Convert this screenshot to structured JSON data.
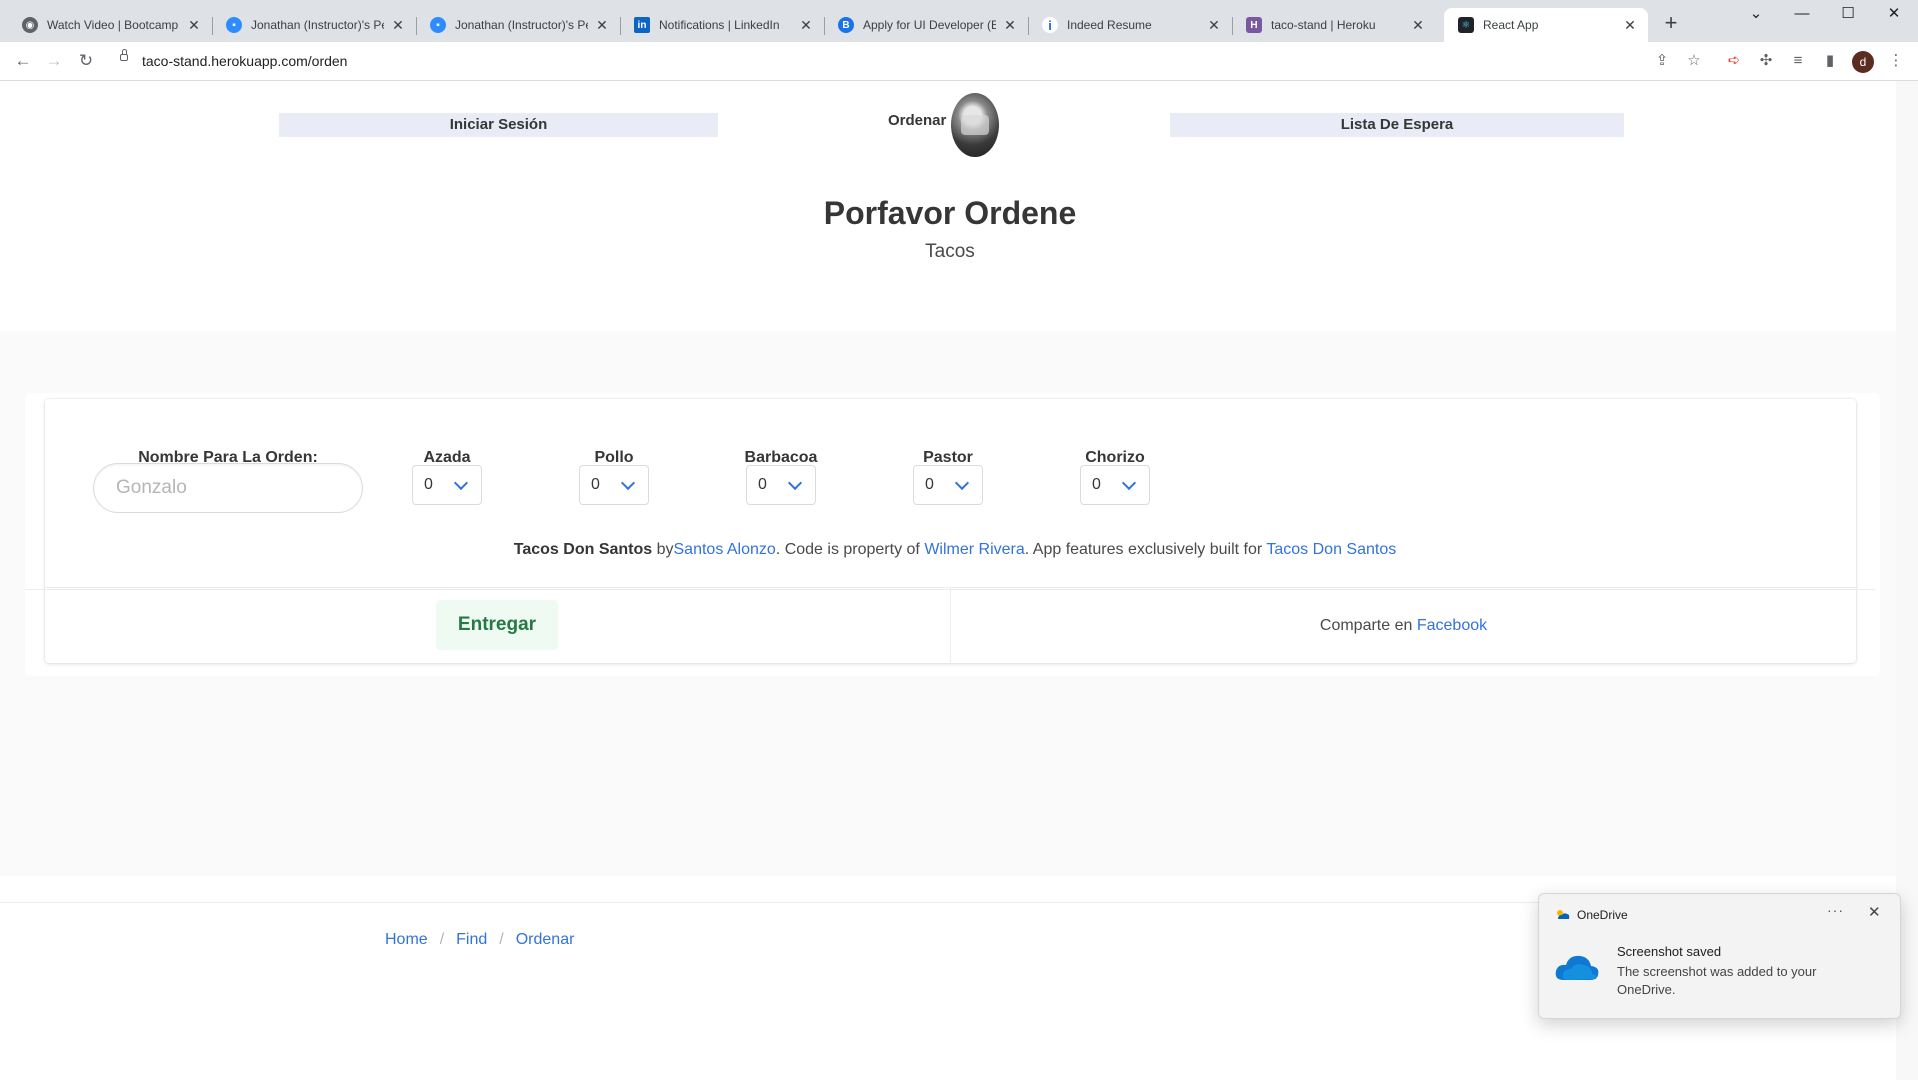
{
  "browser": {
    "tabs": [
      {
        "title": "Watch Video | Bootcamp S",
        "icon": "globe-icon",
        "color": "#5f6368"
      },
      {
        "title": "Jonathan (Instructor)'s Per",
        "icon": "zoom-icon",
        "color": "#2d8cff"
      },
      {
        "title": "Jonathan (Instructor)'s Per",
        "icon": "zoom-icon",
        "color": "#2d8cff"
      },
      {
        "title": "Notifications | LinkedIn",
        "icon": "linkedin-icon",
        "color": "#0a66c2"
      },
      {
        "title": "Apply for UI Developer (En",
        "icon": "b-icon",
        "color": "#1a73e8"
      },
      {
        "title": "Indeed Resume",
        "icon": "indeed-icon",
        "color": "#2164f3"
      },
      {
        "title": "taco-stand | Heroku",
        "icon": "heroku-icon",
        "color": "#79589f"
      },
      {
        "title": "React App",
        "icon": "react-icon",
        "color": "#20232a"
      }
    ],
    "url": "taco-stand.herokuapp.com/orden",
    "profile_initial": "d"
  },
  "nav": {
    "login": "Iniciar Sesión",
    "brand": "Ordenar",
    "waitlist": "Lista De Espera"
  },
  "hero": {
    "title": "Porfavor Ordene",
    "subtitle": "Tacos"
  },
  "form": {
    "name_label": "Nombre Para La Orden:",
    "name_placeholder": "Gonzalo",
    "tacos": [
      {
        "label": "Azada",
        "value": "0"
      },
      {
        "label": "Pollo",
        "value": "0"
      },
      {
        "label": "Barbacoa",
        "value": "0"
      },
      {
        "label": "Pastor",
        "value": "0"
      },
      {
        "label": "Chorizo",
        "value": "0"
      }
    ],
    "submit": "Entregar",
    "share_text": "Comparte en",
    "share_link": "Facebook"
  },
  "credits": {
    "brand": "Tacos Don Santos",
    "by": " by",
    "author": "Santos Alonzo",
    "property_text": ". Code is property of ",
    "owner": "Wilmer Rivera",
    "built_text": ". App features exclusively built for ",
    "client": "Tacos Don Santos"
  },
  "breadcrumb": [
    "Home",
    "Find",
    "Ordenar"
  ],
  "toast": {
    "app": "OneDrive",
    "title": "Screenshot saved",
    "body": "The screenshot was added to your OneDrive."
  },
  "colors": {
    "link": "#3273dc",
    "nav_bg": "#e9ebf6",
    "submit_bg": "#effaf3",
    "submit_text": "#257942"
  }
}
